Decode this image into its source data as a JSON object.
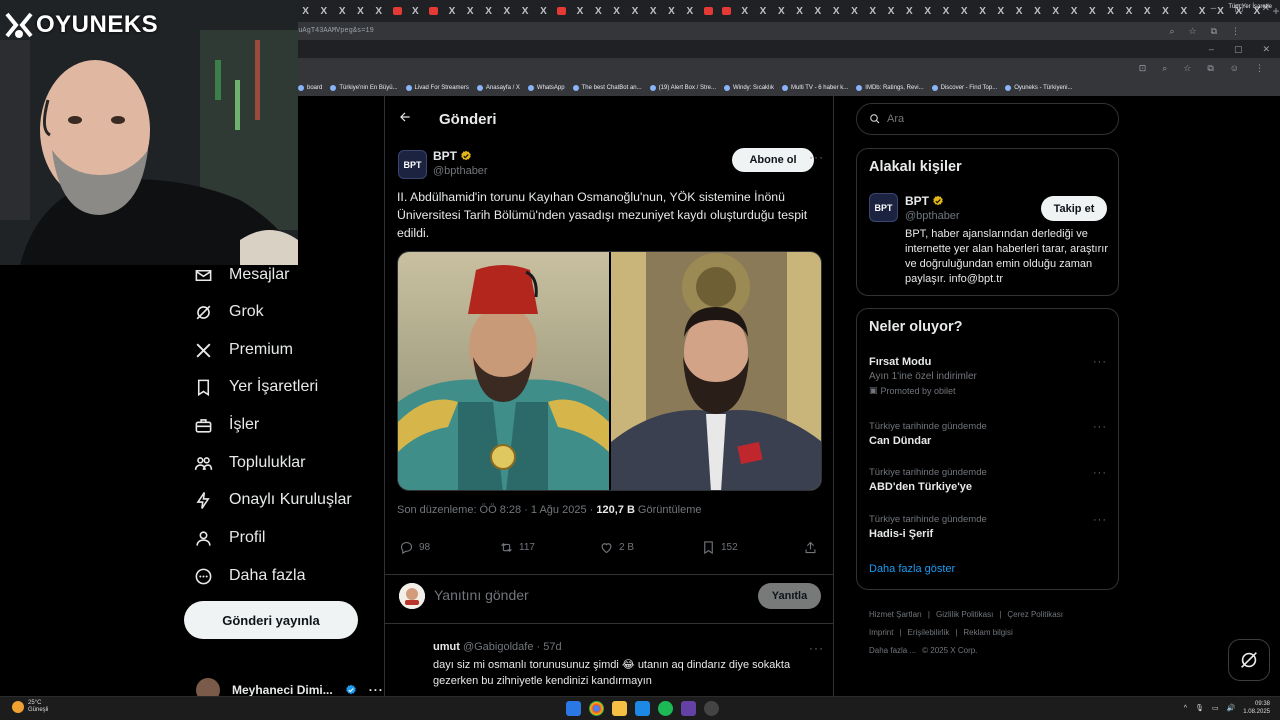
{
  "browser": {
    "tab_glyph": "X",
    "tab_count": 69,
    "red_tabs": [
      9,
      13,
      21,
      23,
      30,
      38,
      39
    ],
    "new_tab": "+",
    "url": "...0942029107884308?t=-6nf-6cNquAgT43AAMVpeg&s=19",
    "bookmarks": [
      "board",
      "Türkiye'nin En Büyü...",
      "Livad For Streamers",
      "Anasayfa / X",
      "WhatsApp",
      "The best ChatBot an...",
      "(19) Alert Box / Stre...",
      "Windy: Sıcaklık",
      "Multi TV - 6 haber k...",
      "IMDb: Ratings, Revi...",
      "Discover - Find Top...",
      "Oyuneks - Türkiyeni..."
    ],
    "all_bookmarks": "Tüm Yer İşaretle"
  },
  "overlay": {
    "brand": "OYUNEKS"
  },
  "nav": {
    "items": [
      {
        "label": "Mesajlar",
        "icon": "envelope-icon"
      },
      {
        "label": "Grok",
        "icon": "grok-icon"
      },
      {
        "label": "Premium",
        "icon": "x-logo-icon"
      },
      {
        "label": "Yer İşaretleri",
        "icon": "bookmark-icon"
      },
      {
        "label": "İşler",
        "icon": "briefcase-icon"
      },
      {
        "label": "Topluluklar",
        "icon": "people-icon"
      },
      {
        "label": "Onaylı Kuruluşlar",
        "icon": "lightning-icon"
      },
      {
        "label": "Profil",
        "icon": "person-icon"
      },
      {
        "label": "Daha fazla",
        "icon": "more-circle-icon"
      }
    ],
    "post_button": "Gönderi yayınla",
    "account_name": "Meyhaneci Dimi..."
  },
  "post": {
    "header_title": "Gönderi",
    "author_name": "BPT",
    "author_handle": "@bpthaber",
    "avatar_text": "BPT",
    "subscribe_label": "Abone ol",
    "text": "II. Abdülhamid'in torunu Kayıhan Osmanoğlu'nun, YÖK sistemine İnönü Üniversitesi Tarih Bölümü'nden yasadışı mezuniyet kaydı oluşturduğu tespit edildi.",
    "meta_edited": "Son düzenleme: ÖÖ 8:28 · 1 Ağu 2025 · ",
    "meta_views": "120,7 B",
    "meta_views_label": "Görüntüleme",
    "replies": "98",
    "reposts": "117",
    "likes": "2 B",
    "bookmarks": "152",
    "reply_placeholder": "Yanıtını gönder",
    "reply_button": "Yanıtla"
  },
  "comment": {
    "name": "umut",
    "handle_time": " @Gabigoldafe · 57d",
    "text": "dayı siz mi osmanlı torunusunuz şimdi 😂 utanın aq dindarız diye sokakta gezerken bu zihniyetle kendinizi kandırmayın"
  },
  "right": {
    "search_placeholder": "Ara",
    "relevant_title": "Alakalı kişiler",
    "rel_name": "BPT",
    "rel_handle": "@bpthaber",
    "follow_label": "Takip et",
    "rel_bio": "BPT, haber ajanslarından derlediği ve internette yer alan haberleri tarar, araştırır ve doğruluğundan emin olduğu zaman paylaşır. info@bpt.tr",
    "trends_title": "Neler oluyor?",
    "trends": [
      {
        "title": "Fırsat Modu",
        "sub": "Ayın 1'ine özel indirimler",
        "promo": "Promoted by obilet"
      },
      {
        "category": "Türkiye tarihinde gündemde",
        "title": "Can Dündar"
      },
      {
        "category": "Türkiye tarihinde gündemde",
        "title": "ABD'den Türkiye'ye"
      },
      {
        "category": "Türkiye tarihinde gündemde",
        "title": "Hadis-i Şerif"
      }
    ],
    "trends_more": "Daha fazla göster",
    "footer": [
      "Hizmet Şartları",
      "Gizlilik Politikası",
      "Çerez Politikası",
      "Imprint",
      "Erişilebilirlik",
      "Reklam bilgisi",
      "Daha fazla ...",
      "© 2025 X Corp."
    ]
  },
  "taskbar": {
    "temp": "25°C",
    "weather": "Güneşli",
    "time": "09:38",
    "date": "1.08.2025"
  },
  "colors": {
    "accent": "#1d9bf0",
    "verified_gold": "#e2b719",
    "border": "#2f3336",
    "muted": "#71767b"
  }
}
